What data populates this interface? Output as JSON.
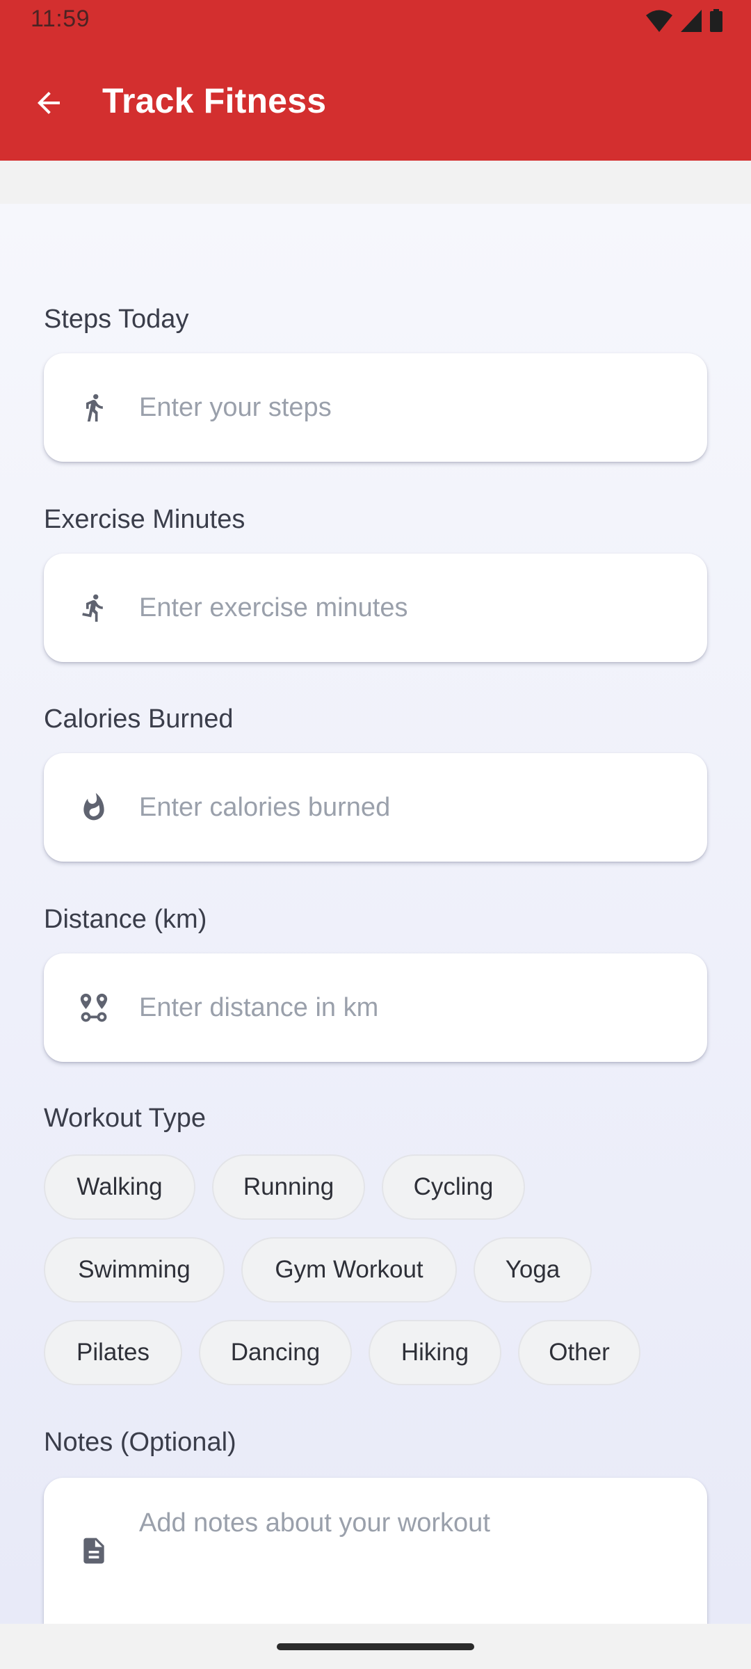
{
  "status_bar": {
    "time": "11:59",
    "icons": [
      "wifi-icon",
      "signal-icon",
      "battery-icon"
    ]
  },
  "app_bar": {
    "title": "Track Fitness",
    "back_icon": "arrow-left-icon",
    "color": "#d32f2f"
  },
  "form": {
    "steps": {
      "label": "Steps Today",
      "placeholder": "Enter your steps",
      "icon": "walking-person-icon"
    },
    "exercise": {
      "label": "Exercise Minutes",
      "placeholder": "Enter exercise minutes",
      "icon": "running-person-icon"
    },
    "calories": {
      "label": "Calories Burned",
      "placeholder": "Enter calories burned",
      "icon": "flame-icon"
    },
    "distance": {
      "label": "Distance (km)",
      "placeholder": "Enter distance in km",
      "icon": "route-icon"
    },
    "workout_type": {
      "label": "Workout Type",
      "options": [
        "Walking",
        "Running",
        "Cycling",
        "Swimming",
        "Gym Workout",
        "Yoga",
        "Pilates",
        "Dancing",
        "Hiking",
        "Other"
      ]
    },
    "notes": {
      "label": "Notes (Optional)",
      "placeholder": "Add notes about your workout",
      "icon": "document-icon"
    }
  }
}
